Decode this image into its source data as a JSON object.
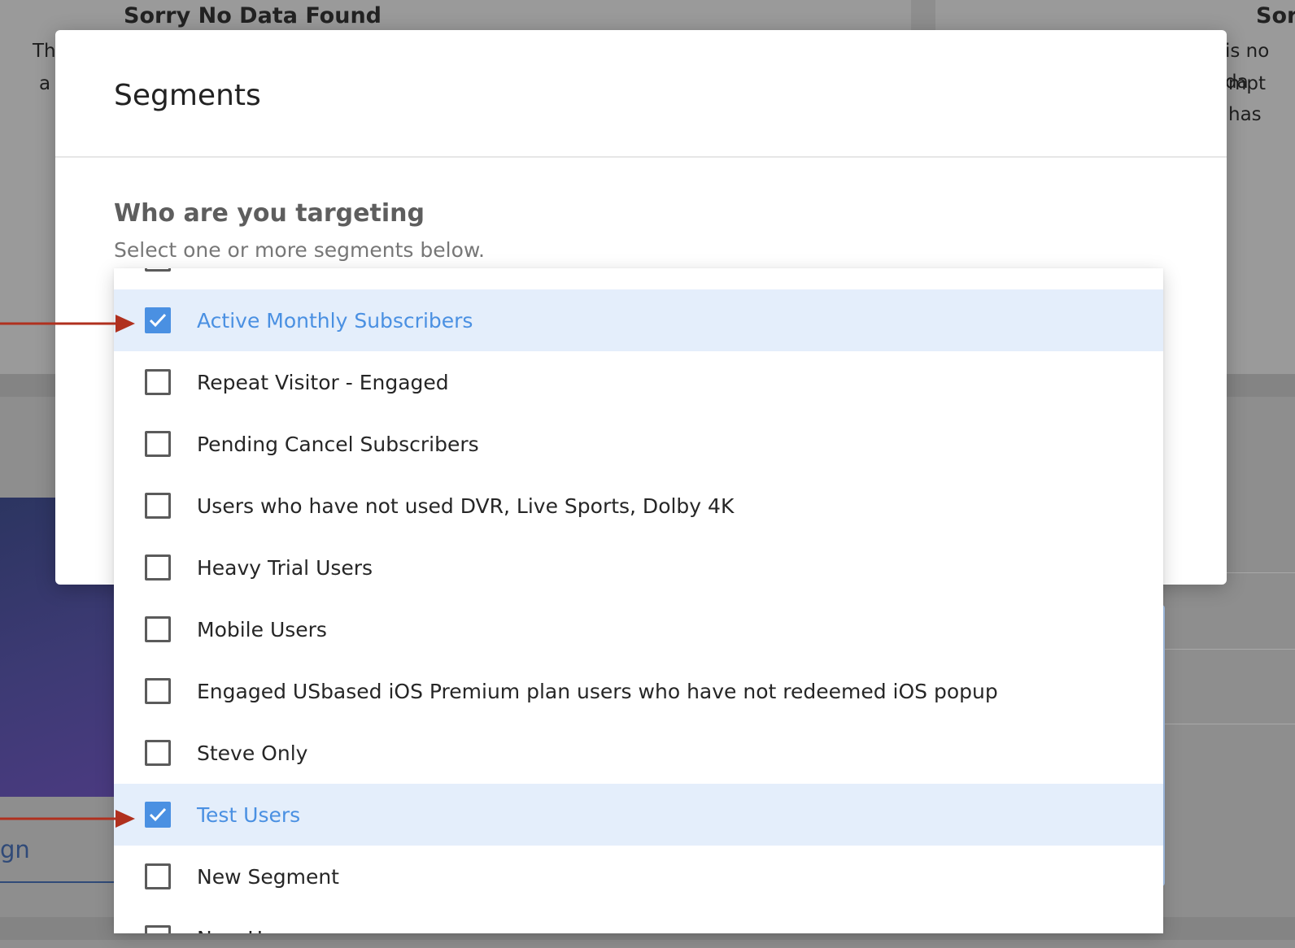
{
  "background": {
    "left_card": {
      "title": "Sorry No Data Found",
      "line1": "Th",
      "line2": "a"
    },
    "right_card": {
      "title": "Sor",
      "line1": "is no da",
      "line2": "mpt has"
    },
    "bottom_link": "gn"
  },
  "modal": {
    "title": "Segments",
    "section_heading": "Who are you targeting",
    "section_help": "Select one or more segments below."
  },
  "dropdown": {
    "options": [
      {
        "label": "",
        "checked": false
      },
      {
        "label": "Active Monthly Subscribers",
        "checked": true
      },
      {
        "label": "Repeat Visitor - Engaged",
        "checked": false
      },
      {
        "label": "Pending Cancel Subscribers",
        "checked": false
      },
      {
        "label": "Users who have not used DVR, Live Sports, Dolby 4K",
        "checked": false
      },
      {
        "label": "Heavy Trial Users",
        "checked": false
      },
      {
        "label": "Mobile Users",
        "checked": false
      },
      {
        "label": "Engaged USbased iOS Premium plan users who have not redeemed iOS popup",
        "checked": false
      },
      {
        "label": "Steve Only",
        "checked": false
      },
      {
        "label": "Test Users",
        "checked": true
      },
      {
        "label": "New Segment",
        "checked": false
      },
      {
        "label": "New Users",
        "checked": false
      }
    ]
  },
  "colors": {
    "accent": "#4a90e2",
    "selected_row": "#e4eefb",
    "annotation_arrow": "#b0301e",
    "overlay": "#8e8e8e"
  },
  "icons": {
    "checkbox_checked": "checkmark-icon",
    "annotation": "arrow-right-icon"
  }
}
